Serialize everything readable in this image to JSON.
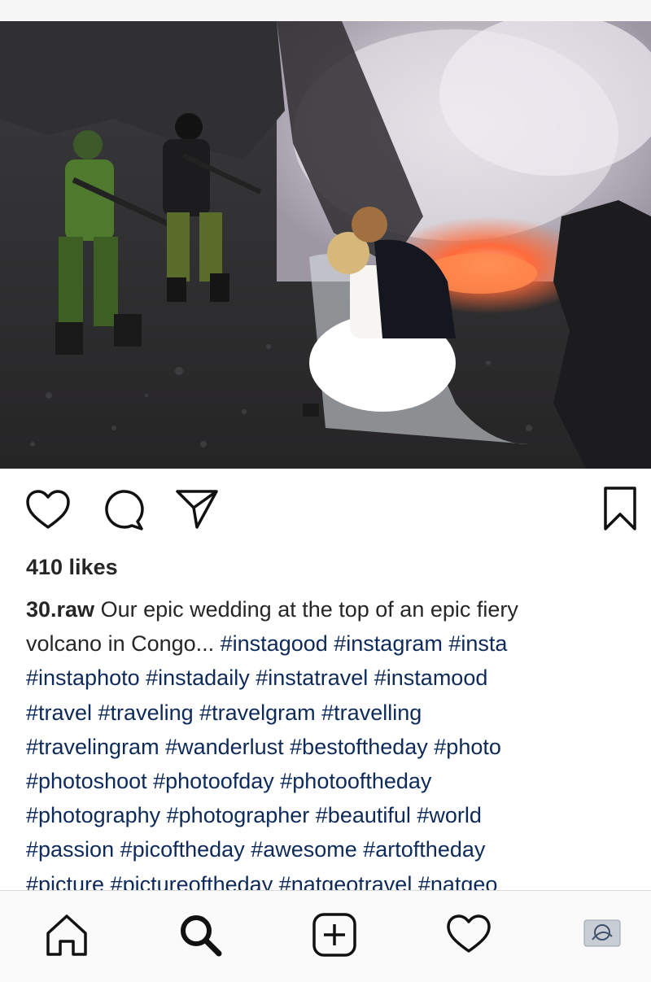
{
  "post": {
    "likes": "410 likes",
    "username": "30.raw",
    "caption_lines": [
      "Our epic wedding at the top of an epic fiery",
      "volcano in Congo... ",
      "#instagood #instagram #insta",
      "#instaphoto #instadaily #instatravel #instamood",
      "#travel #traveling #travelgram #travelling",
      "#travelingram #wanderlust #bestoftheday #photo",
      "#photoshoot #photoofday #photooftheday",
      "#photography #photographer #beautiful #world",
      "#passion #picoftheday #awesome #artoftheday",
      "#picture #pictureoftheday #natgeotravel #natgeo"
    ]
  },
  "actions": {
    "icons": [
      "heart-icon",
      "comment-icon",
      "send-icon",
      "bookmark-icon"
    ]
  },
  "nav": {
    "icons": [
      "home-icon",
      "search-icon",
      "add-post-icon",
      "activity-heart-icon",
      "profile-avatar"
    ]
  },
  "colors": {
    "text": "#262626",
    "hashtag": "#0d2a5a",
    "lava": "#ff6a3a",
    "smoke": "#d9d6dc"
  }
}
